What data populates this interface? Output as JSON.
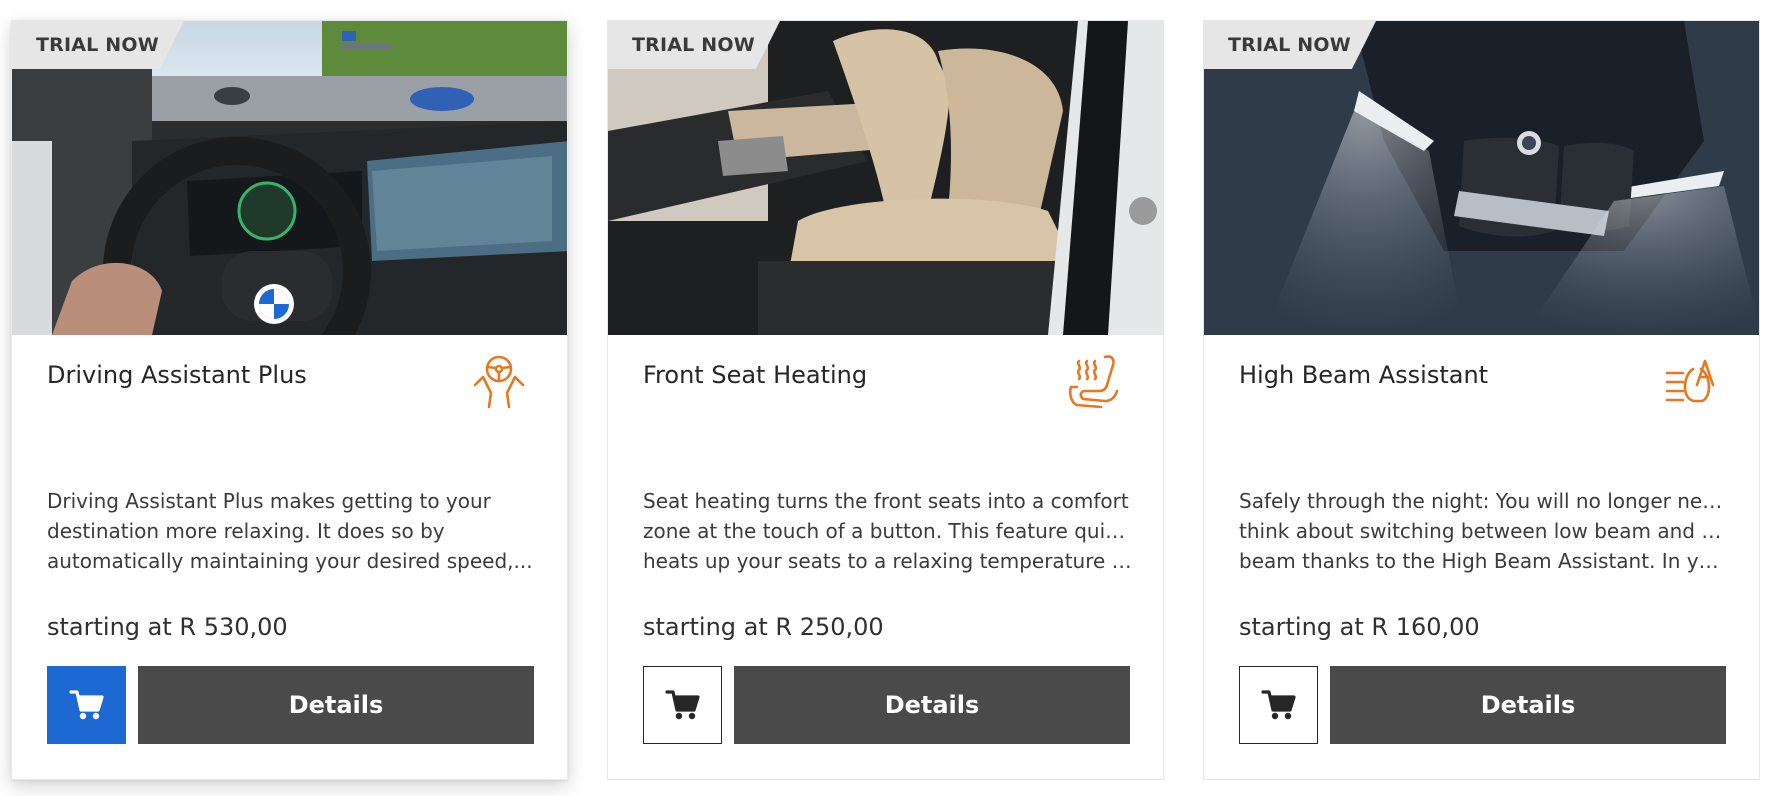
{
  "accent_colors": {
    "icon_orange": "#e87722",
    "primary_blue": "#1c69d4",
    "button_dark": "#4a4a4a",
    "ribbon_gray": "#e6e6e6"
  },
  "cards": [
    {
      "badge": "TRIAL NOW",
      "title": "Driving Assistant Plus",
      "icon": "steering-assist-icon",
      "description_lines": [
        "Driving Assistant Plus makes getting to your",
        "destination more relaxing. It does so by",
        "automatically maintaining your desired speed,..."
      ],
      "price": "starting at R 530,00",
      "cart_icon": "cart-icon",
      "details_label": "Details"
    },
    {
      "badge": "TRIAL NOW",
      "title": "Front Seat Heating",
      "icon": "seat-heating-icon",
      "description_lines": [
        "Seat heating turns the front seats into a comfort",
        "zone at the touch of a button. This feature quickly",
        "heats up your seats to a relaxing temperature yo..."
      ],
      "price": "starting at R 250,00",
      "cart_icon": "cart-icon",
      "details_label": "Details"
    },
    {
      "badge": "TRIAL NOW",
      "title": "High Beam Assistant",
      "icon": "high-beam-assist-icon",
      "description_lines": [
        "Safely through the night: You will no longer need to",
        "think about switching between low beam and high",
        "beam thanks to the High Beam Assistant. In your..."
      ],
      "price": "starting at R 160,00",
      "cart_icon": "cart-icon",
      "details_label": "Details"
    }
  ]
}
